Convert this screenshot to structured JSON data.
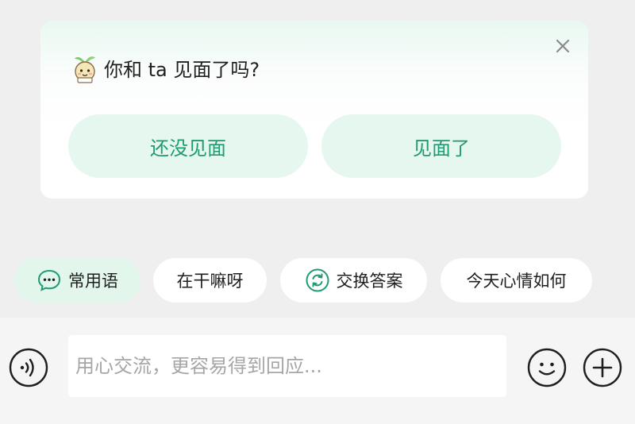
{
  "prompt_card": {
    "question": "你和 ta 见面了吗?",
    "buttons": {
      "not_met": "还没见面",
      "met": "见面了"
    },
    "mascot_icon": "sprout-mascot-icon",
    "close_icon": "close-icon"
  },
  "chips": {
    "common_phrases": "常用语",
    "what_doing": "在干嘛呀",
    "exchange_answers": "交换答案",
    "mood_today": "今天心情如何"
  },
  "composer": {
    "placeholder": "用心交流，更容易得到回应..."
  },
  "colors": {
    "accent_green": "#1f9b72",
    "button_bg": "#e6f7ef"
  }
}
